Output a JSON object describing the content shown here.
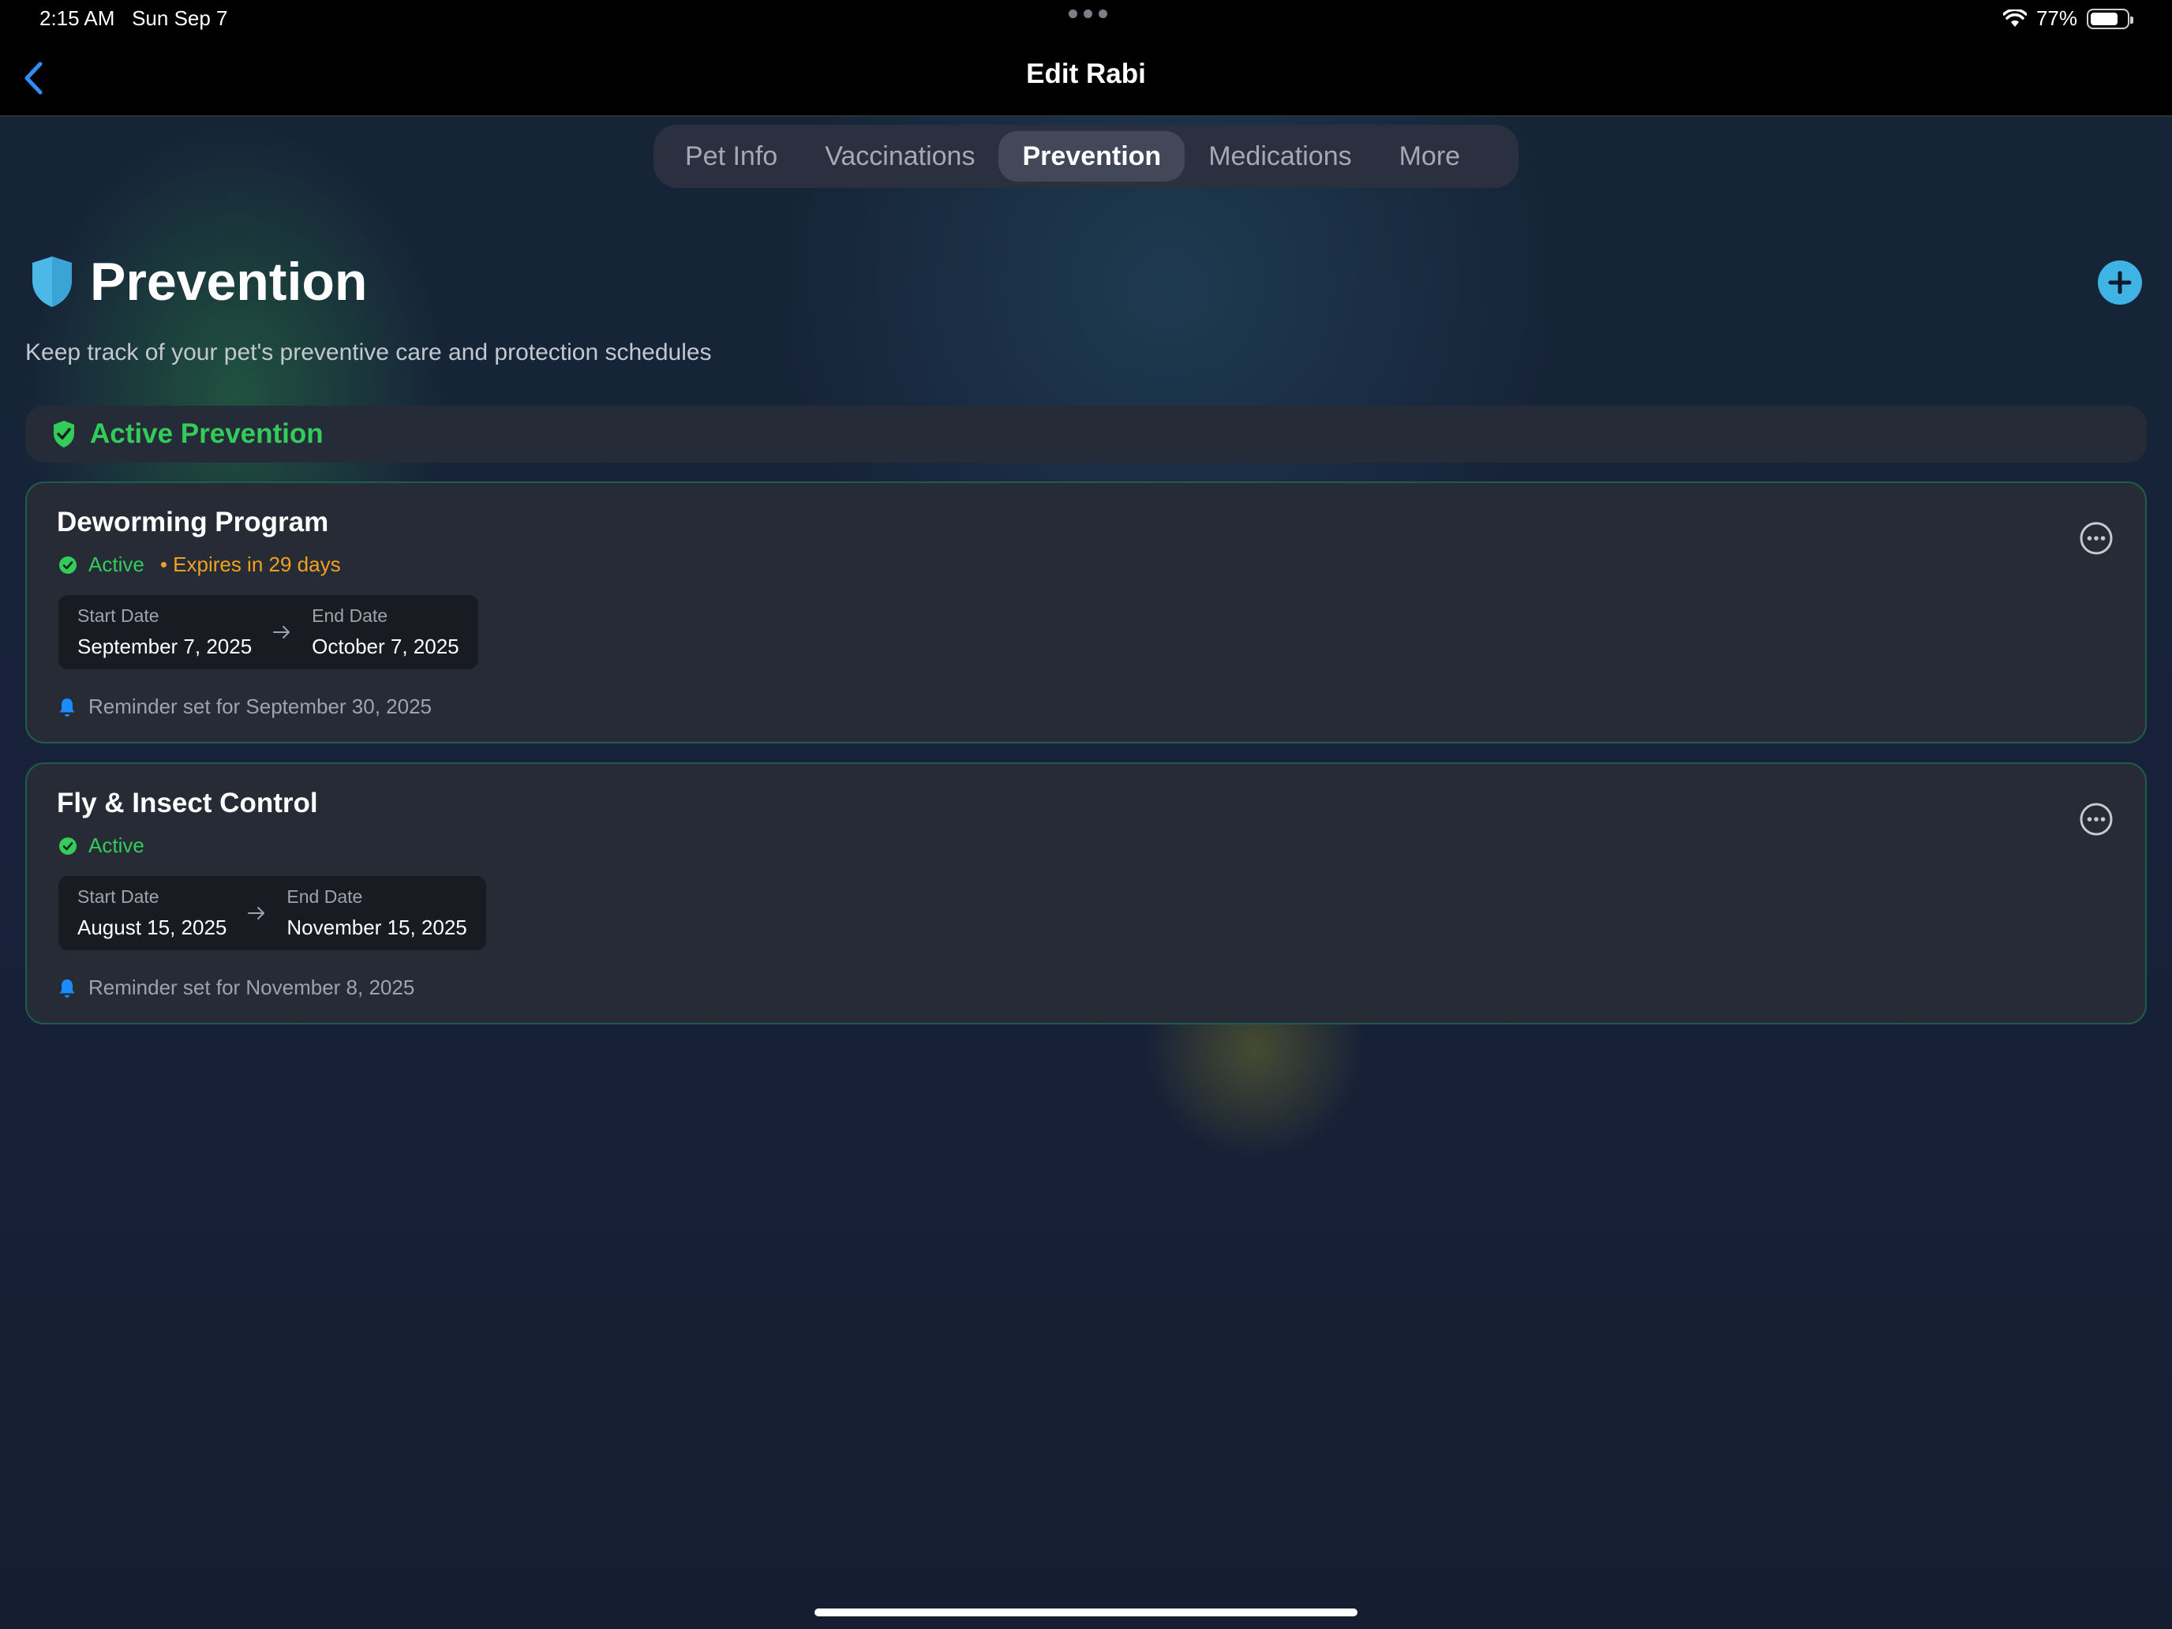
{
  "status_bar": {
    "time": "2:15 AM",
    "date": "Sun Sep 7",
    "battery": "77%",
    "battery_level": 0.77
  },
  "nav": {
    "back_icon": "chevron-left-icon",
    "title": "Edit Rabi"
  },
  "tabs": [
    {
      "label": "Pet Info",
      "active": false
    },
    {
      "label": "Vaccinations",
      "active": false
    },
    {
      "label": "Prevention",
      "active": true
    },
    {
      "label": "Medications",
      "active": false
    },
    {
      "label": "More",
      "active": false
    }
  ],
  "header": {
    "icon": "shield-icon",
    "title": "Prevention",
    "subtitle": "Keep track of your pet's preventive care and protection schedules",
    "add_icon": "plus-icon"
  },
  "section": {
    "icon": "shield-check-icon",
    "label": "Active Prevention"
  },
  "items": [
    {
      "title": "Deworming Program",
      "status": "Active",
      "expires": "• Expires in 29 days",
      "start_label": "Start Date",
      "start_date": "September 7, 2025",
      "end_label": "End Date",
      "end_date": "October 7, 2025",
      "reminder": "Reminder set for September 30, 2025"
    },
    {
      "title": "Fly & Insect Control",
      "status": "Active",
      "expires": "",
      "start_label": "Start Date",
      "start_date": "August 15, 2025",
      "end_label": "End Date",
      "end_date": "November 15, 2025",
      "reminder": "Reminder set for November 8, 2025"
    }
  ],
  "colors": {
    "accent_blue": "#3fb3e4",
    "active_green": "#33cc5a",
    "expires_orange": "#f0a11f",
    "bell_blue": "#1a8cff"
  }
}
